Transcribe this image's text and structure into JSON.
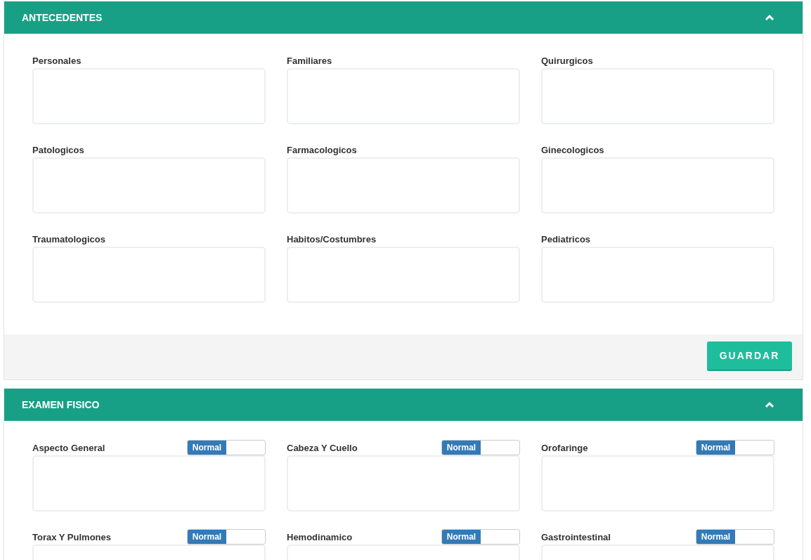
{
  "panels": [
    {
      "title": "ANTECEDENTES",
      "expanded": true,
      "fields": [
        {
          "label": "Personales"
        },
        {
          "label": "Familiares"
        },
        {
          "label": "Quirurgicos"
        },
        {
          "label": "Patologicos"
        },
        {
          "label": "Farmacologicos"
        },
        {
          "label": "Ginecologicos"
        },
        {
          "label": "Traumatologicos"
        },
        {
          "label": "Habitos/Costumbres"
        },
        {
          "label": "Pediatricos"
        }
      ],
      "button": "GUARDAR"
    },
    {
      "title": "EXAMEN FISICO",
      "expanded": true,
      "fields": [
        {
          "label": "Aspecto General",
          "switch": {
            "label": "Normal",
            "on": true
          }
        },
        {
          "label": "Cabeza Y Cuello",
          "switch": {
            "label": "Normal",
            "on": true
          }
        },
        {
          "label": "Orofaringe",
          "switch": {
            "label": "Normal",
            "on": true
          }
        },
        {
          "label": "Torax Y Pulmones",
          "switch": {
            "label": "Normal",
            "on": true
          }
        },
        {
          "label": "Hemodinamico",
          "switch": {
            "label": "Normal",
            "on": true
          }
        },
        {
          "label": "Gastrointestinal",
          "switch": {
            "label": "Normal",
            "on": true
          }
        }
      ]
    }
  ]
}
